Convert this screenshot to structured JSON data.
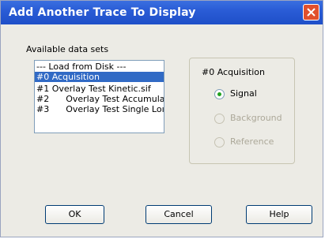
{
  "window": {
    "title": "Add Another Trace To Display"
  },
  "datasets": {
    "label": "Available data sets",
    "items": [
      {
        "label": "--- Load from Disk ---",
        "selected": false
      },
      {
        "label": "#0  Acquisition",
        "selected": true
      },
      {
        "label": "#1  Overlay Test Kinetic.sif",
        "selected": false
      },
      {
        "label": "#2      Overlay Test Accumula",
        "selected": false
      },
      {
        "label": "#3      Overlay Test Single Loı",
        "selected": false
      }
    ]
  },
  "trace_group": {
    "title": "#0  Acquisition",
    "options": [
      {
        "label": "Signal",
        "checked": true,
        "enabled": true
      },
      {
        "label": "Background",
        "checked": false,
        "enabled": false
      },
      {
        "label": "Reference",
        "checked": false,
        "enabled": false
      }
    ]
  },
  "buttons": {
    "ok": "OK",
    "cancel": "Cancel",
    "help": "Help"
  },
  "colors": {
    "titlebar": "#2a5cd6",
    "selection": "#316ac5",
    "radio_dot": "#21a121",
    "close": "#e1502d"
  }
}
